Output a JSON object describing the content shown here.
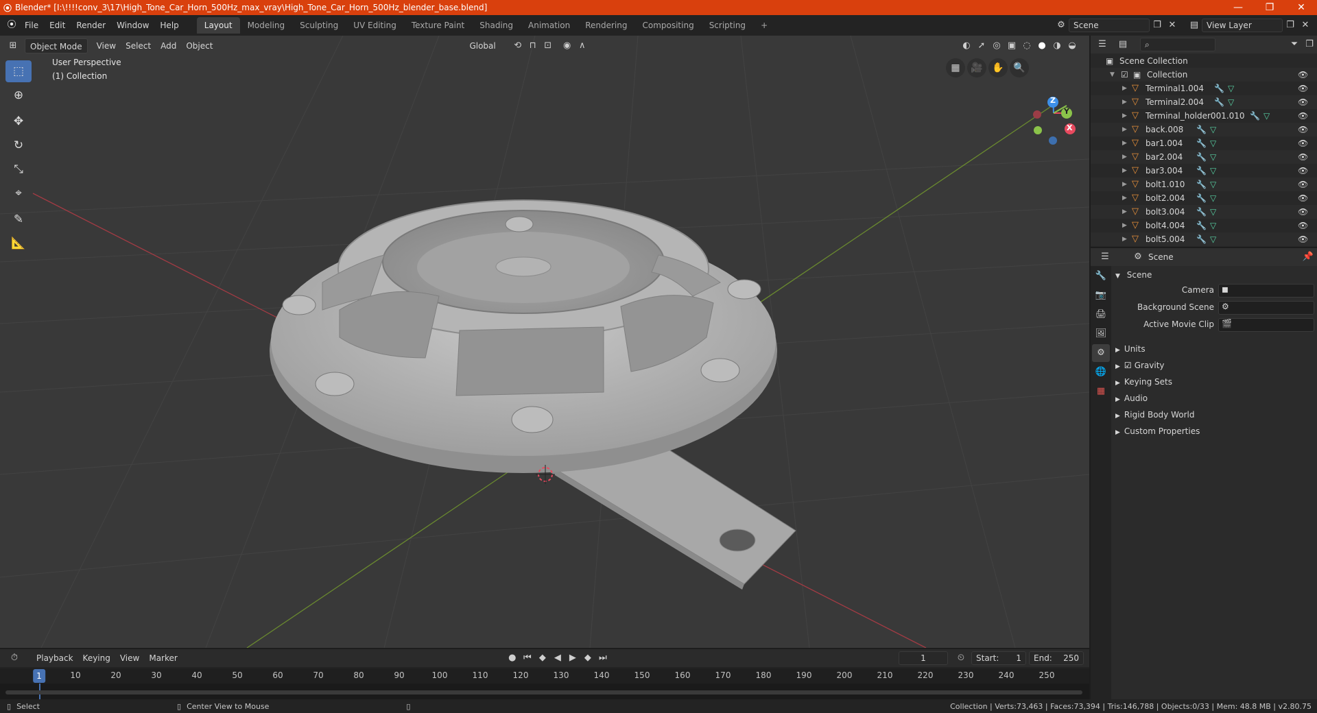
{
  "window": {
    "title": "Blender* [I:\\!!!!conv_3\\17\\High_Tone_Car_Horn_500Hz_max_vray\\High_Tone_Car_Horn_500Hz_blender_base.blend]",
    "minimize": "—",
    "maximize": "❐",
    "close": "✕"
  },
  "menu": [
    "File",
    "Edit",
    "Render",
    "Window",
    "Help"
  ],
  "workspaces": [
    "Layout",
    "Modeling",
    "Sculpting",
    "UV Editing",
    "Texture Paint",
    "Shading",
    "Animation",
    "Rendering",
    "Compositing",
    "Scripting"
  ],
  "workspace_add": "+",
  "scene_field": "Scene",
  "view_layer_field": "View Layer",
  "viewport": {
    "mode": "Object Mode",
    "menus": [
      "View",
      "Select",
      "Add",
      "Object"
    ],
    "transform": "Global",
    "overlay_line1": "User Perspective",
    "overlay_line2": "(1) Collection",
    "gizmo": {
      "x": "X",
      "y": "Y",
      "z": "Z"
    }
  },
  "outliner": {
    "root": "Scene Collection",
    "collection": "Collection",
    "items": [
      "Terminal1.004",
      "Terminal2.004",
      "Terminal_holder001.010",
      "back.008",
      "bar1.004",
      "bar2.004",
      "bar3.004",
      "bolt1.010",
      "bolt2.004",
      "bolt3.004",
      "bolt4.004",
      "bolt5.004"
    ]
  },
  "properties": {
    "context": "Scene",
    "panel": "Scene",
    "camera_label": "Camera",
    "background_label": "Background Scene",
    "movie_clip_label": "Active Movie Clip",
    "sections": [
      "Units",
      "Gravity",
      "Keying Sets",
      "Audio",
      "Rigid Body World",
      "Custom Properties"
    ]
  },
  "timeline": {
    "menus": [
      "Playback",
      "Keying",
      "View",
      "Marker"
    ],
    "current_frame": "1",
    "start_label": "Start:",
    "start": "1",
    "end_label": "End:",
    "end": "250",
    "ticks": [
      "10",
      "20",
      "30",
      "40",
      "50",
      "60",
      "70",
      "80",
      "90",
      "100",
      "110",
      "120",
      "130",
      "140",
      "150",
      "160",
      "170",
      "180",
      "190",
      "200",
      "210",
      "220",
      "230",
      "240",
      "250"
    ],
    "playhead_label": "1"
  },
  "status": {
    "left1": "Select",
    "left2": "Center View to Mouse",
    "right": "Collection | Verts:73,463 | Faces:73,394 | Tris:146,788 | Objects:0/33 | Mem: 48.8 MB | v2.80.75"
  },
  "colors": {
    "title_bar": "#d9400d",
    "accent": "#4772b3",
    "x_axis": "#e84a5f",
    "y_axis": "#8bc34a",
    "z_axis": "#3d8fe8"
  }
}
